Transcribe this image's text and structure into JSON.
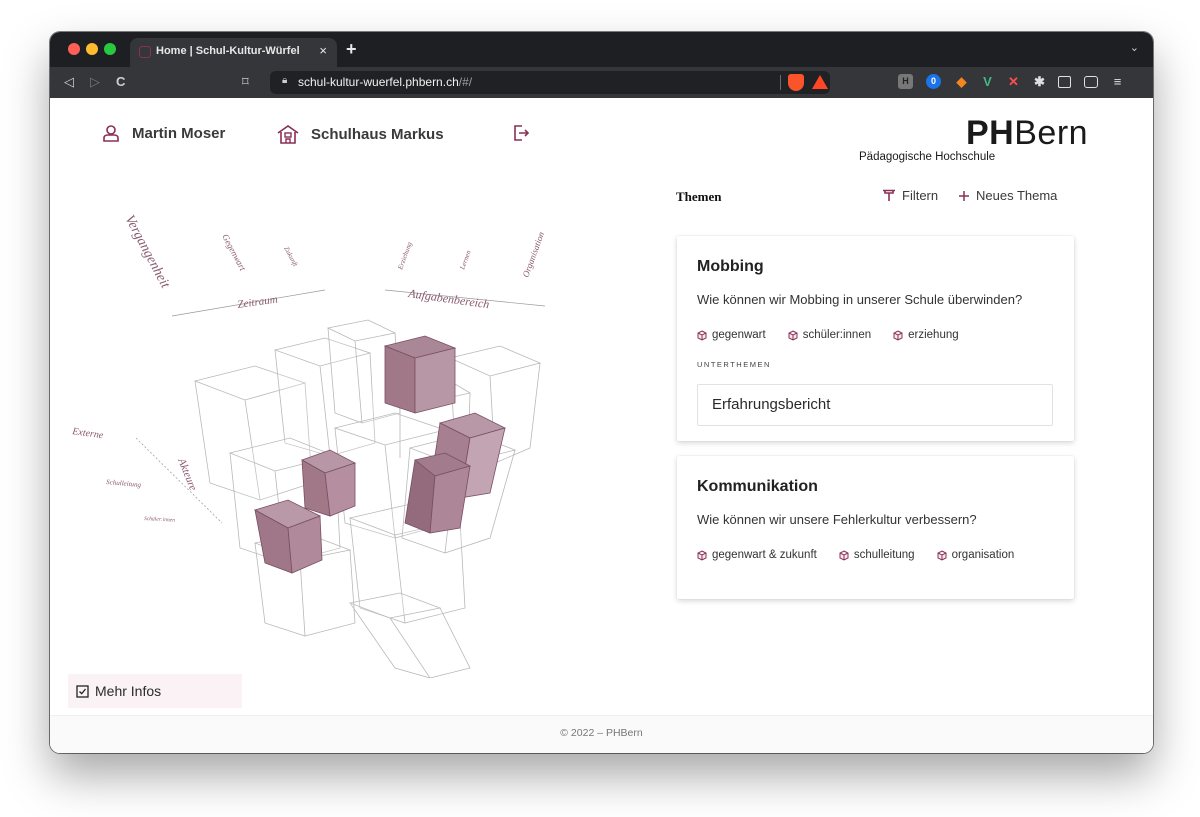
{
  "browser": {
    "tab_title": "Home | Schul-Kultur-Würfel",
    "tab_close": "×",
    "new_tab": "+",
    "url_host": "schul-kultur-wuerfel.phbern.ch",
    "url_path": "/#/"
  },
  "header": {
    "user_name": "Martin Moser",
    "school_name": "Schulhaus Markus",
    "logo_bold": "PH",
    "logo_light": "Bern",
    "logo_subtitle": "Pädagogische Hochschule"
  },
  "cube": {
    "group_labels": [
      "Zeitraum",
      "Aufgabenbereich",
      "Akteure"
    ],
    "time_labels": [
      "Vergangenheit",
      "Gegenwart",
      "Zukunft"
    ],
    "area_labels": [
      "Erziehung",
      "Lernen",
      "Organisation"
    ],
    "actor_labels": [
      "Externe",
      "Schulleitung",
      "Schüler:innen"
    ]
  },
  "themes": {
    "title": "Themen",
    "filter_label": "Filtern",
    "new_label": "Neues Thema",
    "cards": [
      {
        "title": "Mobbing",
        "question": "Wie können wir Mobbing in unserer Schule überwinden?",
        "tags": [
          "gegenwart",
          "schüler:innen",
          "erziehung"
        ],
        "subthemes_label": "UNTERTHEMEN",
        "subthemes": [
          "Erfahrungsbericht"
        ]
      },
      {
        "title": "Kommunikation",
        "question": "Wie können wir unsere Fehlerkultur verbessern?",
        "tags": [
          "gegenwart & zukunft",
          "schulleitung",
          "organisation"
        ]
      }
    ]
  },
  "more_info": "Mehr Infos",
  "footer": "© 2022 – PHBern",
  "colors": {
    "accent": "#8a2f55",
    "cube_fill": "#a07888"
  }
}
